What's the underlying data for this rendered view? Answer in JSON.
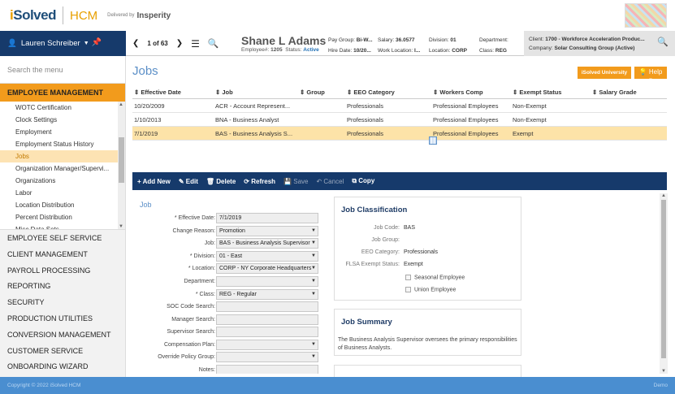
{
  "brand": {
    "name_i": "i",
    "name_rest": "Solved",
    "product": "HCM",
    "delivered_by": "Delivered by",
    "partner": "Insperity"
  },
  "header": {
    "user": "Lauren Schreiber",
    "pager": "1 of 63",
    "employee_name": "Shane L Adams",
    "employee_number_label": "Employee#:",
    "employee_number": "1205",
    "status_label": "Status:",
    "status": "Active",
    "meta": [
      {
        "label": "Pay Group:",
        "value": "Bi-W..."
      },
      {
        "label": "Hire Date:",
        "value": "10/20..."
      },
      {
        "label": "Salary:",
        "value": "36.0577"
      },
      {
        "label": "Work Location:",
        "value": "I..."
      },
      {
        "label": "Division:",
        "value": "01"
      },
      {
        "label": "Location:",
        "value": "CORP"
      },
      {
        "label": "Department:",
        "value": ""
      },
      {
        "label": "Class:",
        "value": "REG"
      }
    ],
    "client_label": "Client:",
    "client": "1700 - Workforce Acceleration Produc...",
    "company_label": "Company:",
    "company": "Solar Consulting Group (Active)"
  },
  "sidebar": {
    "search_placeholder": "Search the menu",
    "section": "EMPLOYEE MANAGEMENT",
    "sub_items": [
      "WOTC Certification",
      "Clock Settings",
      "Employment",
      "Employment Status History",
      "Jobs",
      "Organization Manager/Supervi...",
      "Organizations",
      "Labor",
      "Location Distribution",
      "Percent Distribution",
      "Misc Data Sets"
    ],
    "selected_sub": "Jobs",
    "top_items": [
      "EMPLOYEE SELF SERVICE",
      "CLIENT MANAGEMENT",
      "PAYROLL PROCESSING",
      "REPORTING",
      "SECURITY",
      "PRODUCTION UTILITIES",
      "CONVERSION MANAGEMENT",
      "CUSTOMER SERVICE",
      "ONBOARDING WIZARD"
    ]
  },
  "main": {
    "title": "Jobs",
    "university_label": "iSolved University",
    "help_label": "Help",
    "grid": {
      "columns": [
        "Effective Date",
        "Job",
        "Group",
        "EEO Category",
        "Workers Comp",
        "Exempt Status",
        "Salary Grade"
      ],
      "rows": [
        [
          "10/20/2009",
          "ACR - Account Represent...",
          "",
          "Professionals",
          "Professional Employees",
          "Non-Exempt",
          ""
        ],
        [
          "1/10/2013",
          "BNA - Business Analyst",
          "",
          "Professionals",
          "Professional Employees",
          "Non-Exempt",
          ""
        ],
        [
          "7/1/2019",
          "BAS - Business Analysis S...",
          "",
          "Professionals",
          "Professional Employees",
          "Exempt",
          ""
        ]
      ],
      "selected_row": 2
    },
    "toolbar": {
      "add": "Add New",
      "edit": "Edit",
      "delete": "Delete",
      "refresh": "Refresh",
      "save": "Save",
      "cancel": "Cancel",
      "copy": "Copy"
    },
    "form": {
      "heading": "Job",
      "fields": [
        {
          "label": "* Effective Date:",
          "value": "7/1/2019",
          "dropdown": false
        },
        {
          "label": "Change Reason:",
          "value": "Promotion",
          "dropdown": true
        },
        {
          "label": "Job:",
          "value": "BAS - Business Analysis Supervisor",
          "dropdown": true
        },
        {
          "label": "* Division:",
          "value": "01 - East",
          "dropdown": true
        },
        {
          "label": "* Location:",
          "value": "CORP - NY Corporate Headquarters",
          "dropdown": true
        },
        {
          "label": "Department:",
          "value": "",
          "dropdown": true
        },
        {
          "label": "* Class:",
          "value": "REG - Regular",
          "dropdown": true
        },
        {
          "label": "SOC Code Search:",
          "value": "",
          "dropdown": false
        },
        {
          "label": "Manager Search:",
          "value": "",
          "dropdown": false
        },
        {
          "label": "Supervisor Search:",
          "value": "",
          "dropdown": false
        },
        {
          "label": "Compensation Plan:",
          "value": "",
          "dropdown": true
        },
        {
          "label": "Override Policy Group:",
          "value": "",
          "dropdown": true
        },
        {
          "label": "Notes:",
          "value": "",
          "dropdown": false
        }
      ]
    },
    "classification": {
      "title": "Job Classification",
      "rows": [
        {
          "label": "Job Code:",
          "value": "BAS"
        },
        {
          "label": "Job Group:",
          "value": ""
        },
        {
          "label": "EEO Category:",
          "value": "Professionals"
        },
        {
          "label": "FLSA Exempt Status:",
          "value": "Exempt"
        }
      ],
      "checks": [
        "Seasonal Employee",
        "Union Employee"
      ]
    },
    "summary": {
      "title": "Job Summary",
      "text": "The Business Analysis Supervisor oversees the primary responsibilities of Business Analysts."
    }
  },
  "footer": {
    "copyright": "Copyright © 2022 iSolved HCM",
    "env": "Demo"
  }
}
